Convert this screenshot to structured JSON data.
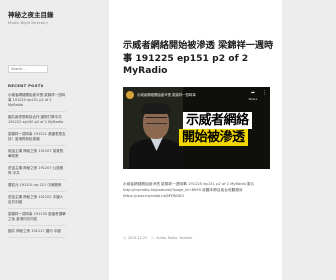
{
  "site": {
    "title": "神秘之夜主目錄",
    "description": "Mystic Night Directory"
  },
  "search": {
    "placeholder": "Search ..."
  },
  "recent": {
    "heading": "RECENT POSTS",
    "items": [
      "示威者網絡開始被滲透 梁錦祥一週時事 191225 ep151 p2 of 2 MyRadio",
      "國共兩黨想和談合作 國際打擊中共 191222 ep150 p2 of 2 MyRadio",
      "梁錦祥一週時事 191221 美國表態支持！香港再掀民運潮",
      "姬宙主講 神秘之夜 191207 英美對華政策",
      "莊宙主講 神秘之夜 191207 公投都係 中共",
      "蕭若元 191201 ep 211 中美關係",
      "莊宙主講 神秘之夜 191202 中國人反抗中國",
      "梁錦祥一週時事 191130 區議會選舉之後 香港何去何從",
      "國共 神秘之夜 191117 國內 中國"
    ]
  },
  "post": {
    "title": "示威者網絡開始被滲透 梁錦祥一週時事 191225 ep151 p2 of 2 MyRadio",
    "video": {
      "caption": "示威者網絡開始被滲透 梁錦祥一週時事",
      "share_label": "Share",
      "overlay_line1": "示威者網絡",
      "overlay_line2": "開始被滲透"
    },
    "excerpt": "示威者網絡開始被滲透 梁錦祥一週時事 191225 ep151 p2 of 2 MyRadio 影片 http://myradio.hk/podcast/?page_id=8999 收聽本節目各台收聽程序 https://user.myradio.hk/MYRADIO",
    "meta": {
      "date": "2019-12-25",
      "categories": "Audio, Radio, Youtube"
    }
  },
  "colors": {
    "page_bg": "#ececec",
    "card_bg": "#ffffff",
    "overlay_yellow": "#f2d600"
  }
}
